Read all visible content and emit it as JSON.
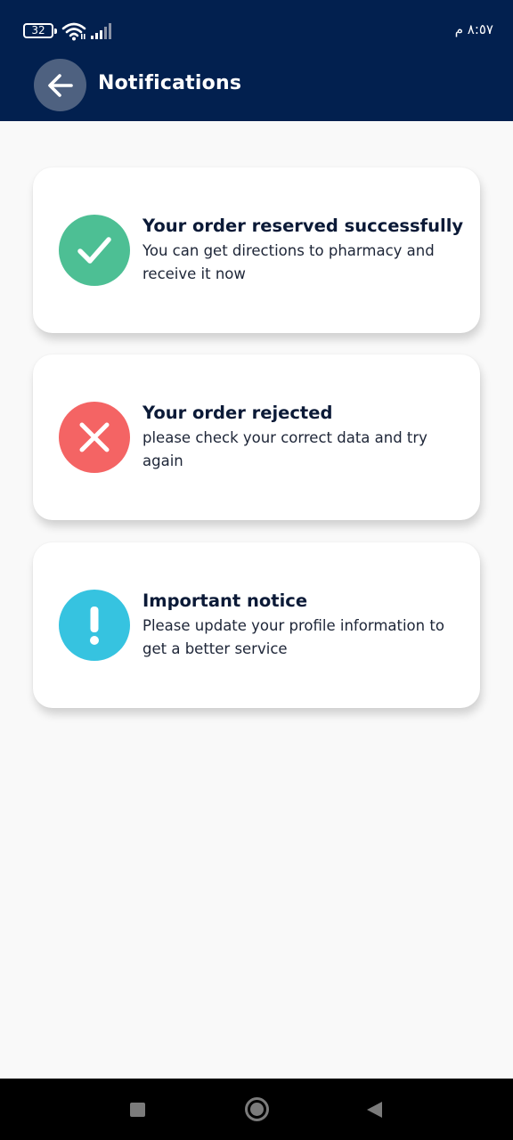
{
  "status_bar": {
    "battery_level": "32",
    "clock": "٨:٥٧ م",
    "icons": [
      "battery-icon",
      "wifi-icon",
      "signal-icon"
    ]
  },
  "header": {
    "title": "Notifications",
    "back_icon": "arrow-left-icon",
    "background_color": "#02204f"
  },
  "notifications": [
    {
      "type": "success",
      "icon": "check-icon",
      "color": "#4dbf94",
      "title": "Your order reserved successfully",
      "message": "You can get directions to pharmacy and receive it now"
    },
    {
      "type": "error",
      "icon": "close-icon",
      "color": "#f46464",
      "title": "Your order rejected",
      "message": "please check your correct data and try again"
    },
    {
      "type": "info",
      "icon": "exclamation-icon",
      "color": "#36c3e0",
      "title": "Important notice",
      "message": "Please update your profile information to get a better service"
    }
  ],
  "nav_bar": {
    "icons": [
      "recents-icon",
      "home-icon",
      "back-icon"
    ]
  }
}
